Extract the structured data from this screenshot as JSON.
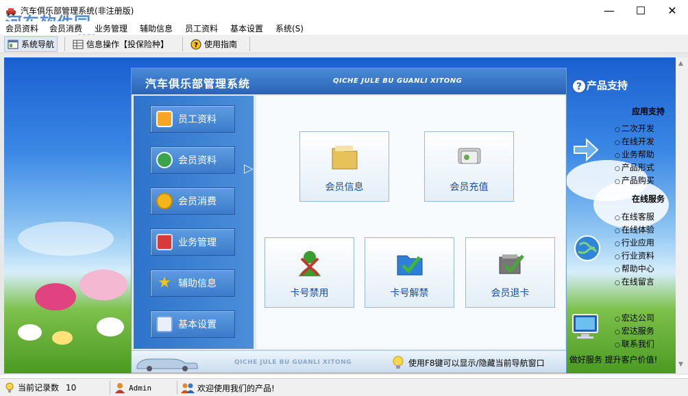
{
  "window": {
    "title": "汽车俱乐部管理系统(非注册版)",
    "watermark": "河东软件园",
    "watermark_url": "www.pc0359.cn",
    "min_glyph": "—",
    "max_glyph": "☐",
    "close_glyph": "✕"
  },
  "menu": [
    "会员资料",
    "会员消费",
    "业务管理",
    "辅助信息",
    "员工资料",
    "基本设置",
    "系统(S)"
  ],
  "toolbar": {
    "nav_label": "系统导航",
    "ops_label": "信息操作【投保险种】",
    "guide_label": "使用指南"
  },
  "panel": {
    "title": "汽车俱乐部管理系统",
    "pinyin": "QICHE JULE BU GUANLI XITONG",
    "footer_pinyin": "QICHE JULE BU GUANLI XITONG",
    "footer_tip": "使用F8键可以显示/隐藏当前导航窗口"
  },
  "nav": [
    {
      "label": "员工资料",
      "icon": "staff-icon",
      "color": "#f5a623"
    },
    {
      "label": "会员资料",
      "icon": "members-icon",
      "color": "#3aa44a"
    },
    {
      "label": "会员消费",
      "icon": "coins-icon",
      "color": "#f2b61b"
    },
    {
      "label": "业务管理",
      "icon": "monitor-icon",
      "color": "#d63a3a"
    },
    {
      "label": "辅助信息",
      "icon": "star-icon",
      "color": "#f6c21c"
    },
    {
      "label": "基本设置",
      "icon": "settings-icon",
      "color": "#4b8ed9"
    }
  ],
  "tiles": [
    {
      "label": "会员信息",
      "icon": "folder-icon",
      "color": "#e7c15a"
    },
    {
      "label": "会员充值",
      "icon": "card-stack-icon",
      "color": "#6aa84f"
    },
    {
      "label": "卡号禁用",
      "icon": "user-forbid-icon",
      "color": "#3b9d2f"
    },
    {
      "label": "卡号解禁",
      "icon": "folder-check-icon",
      "color": "#2e7fd6"
    },
    {
      "label": "会员退卡",
      "icon": "box-check-icon",
      "color": "#4aa33b"
    }
  ],
  "support": {
    "title": "产品支持",
    "sections": [
      {
        "title": "应用支持",
        "items": [
          "二次开发",
          "在线开发",
          "业务帮助",
          "产品形式",
          "产品购买"
        ]
      },
      {
        "title": "在线服务",
        "items": [
          "在线客服",
          "在线体验",
          "行业应用",
          "行业资料",
          "帮助中心",
          "在线留言"
        ]
      },
      {
        "title": "",
        "items": [
          "宏达公司",
          "宏达服务",
          "联系我们"
        ]
      }
    ],
    "slogan": "品 做好服务 提升客户价值!"
  },
  "status": {
    "records_label": "当前记录数",
    "records_count": "10",
    "user": "Admin",
    "welcome": "欢迎使用我们的产品!"
  },
  "colors": {
    "accent": "#2a64b8",
    "nav_bg": "#2e74cc",
    "tile_text": "#1a4c9c"
  }
}
